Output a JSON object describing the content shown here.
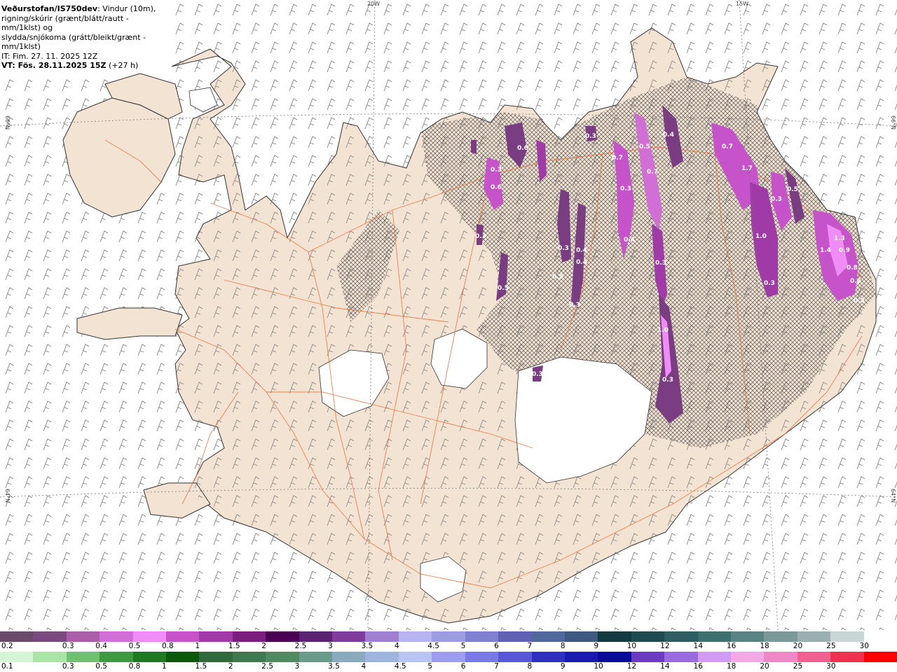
{
  "title": {
    "source": "Veðurstofan/IS750dev",
    "description": ": Vindur (10m),",
    "line2": "rigning/skúrir (grænt/blátt/rautt - mm/1klst) og",
    "line3": "slydda/snjókoma (grátt/bleikt/grænt - mm/1klst)",
    "issue_time": "IT: Fim. 27. 11. 2025 12Z",
    "valid_time": "VT: Fös. 28.11.2025 15Z",
    "lead": "(+27 h)"
  },
  "grid_labels": {
    "lon_20w": "20W",
    "lon_15w": "15W",
    "lat_66_left": "66°N",
    "lat_66_right": "66°N",
    "lat_64_left": "64°N",
    "lat_64_right": "64°N"
  },
  "precip_labels": [
    "0.6",
    "0.3",
    "0.6",
    "0.3",
    "0.4",
    "0.5",
    "0.7",
    "0.3",
    "0.7",
    "0.7",
    "1.7",
    "0.5",
    "0.3",
    "0.4",
    "0.3",
    "0.4",
    "0.3",
    "0.4",
    "0.3",
    "1.0",
    "1.3",
    "1.4",
    "0.9",
    "0.6",
    "0.3",
    "0.8",
    "0.3",
    "0.5",
    "0.3",
    "0.5",
    "0.3",
    "0.7",
    "0.3",
    "1.0"
  ],
  "legend_snow": {
    "values": [
      "0.2",
      "0.3",
      "0.4",
      "0.5",
      "0.8",
      "1",
      "1.5",
      "2",
      "2.5",
      "3",
      "3.5",
      "4",
      "4.5",
      "5",
      "6",
      "7",
      "8",
      "9",
      "10",
      "12",
      "14",
      "16",
      "18",
      "20",
      "25",
      "30"
    ],
    "colors": [
      "#6b4a6b",
      "#7a4a7e",
      "#a85fa8",
      "#d16fd6",
      "#f08cf5",
      "#c653c9",
      "#a03aa6",
      "#7a1f7e",
      "#4a0050",
      "#5a2470",
      "#7e3d9a",
      "#a07fd0",
      "#b8b4f0",
      "#9c9ce0",
      "#8080d0",
      "#6060b4",
      "#4f6a9a",
      "#3e5a80",
      "#123a40",
      "#1f4a50",
      "#2e5e62",
      "#3e7070",
      "#5a8484",
      "#7a9a9a",
      "#9ab0b0",
      "#c9d6d6",
      "#ffffff"
    ]
  },
  "legend_rain": {
    "values": [
      "0.1",
      "0.3",
      "0.5",
      "0.8",
      "1",
      "1.5",
      "2",
      "2.5",
      "3",
      "3.5",
      "4",
      "4.5",
      "5",
      "6",
      "7",
      "8",
      "9",
      "10",
      "12",
      "14",
      "16",
      "18",
      "20",
      "25",
      "30"
    ],
    "colors": [
      "#d6f5d6",
      "#a8e6a8",
      "#6fc06f",
      "#3e9a3e",
      "#1f7a1f",
      "#0a5a0a",
      "#2e6a3e",
      "#3e7a50",
      "#4e8a62",
      "#6a9a8a",
      "#8aaabe",
      "#a0b4e0",
      "#b8c4f5",
      "#9c9cf0",
      "#7a7ae6",
      "#5858d6",
      "#3030c0",
      "#1a1ab0",
      "#0a0a9a",
      "#6a3ac0",
      "#9a6ae0",
      "#d09af5",
      "#f5a8e6",
      "#f088c8",
      "#f06090",
      "#f03050",
      "#ff0000"
    ]
  }
}
